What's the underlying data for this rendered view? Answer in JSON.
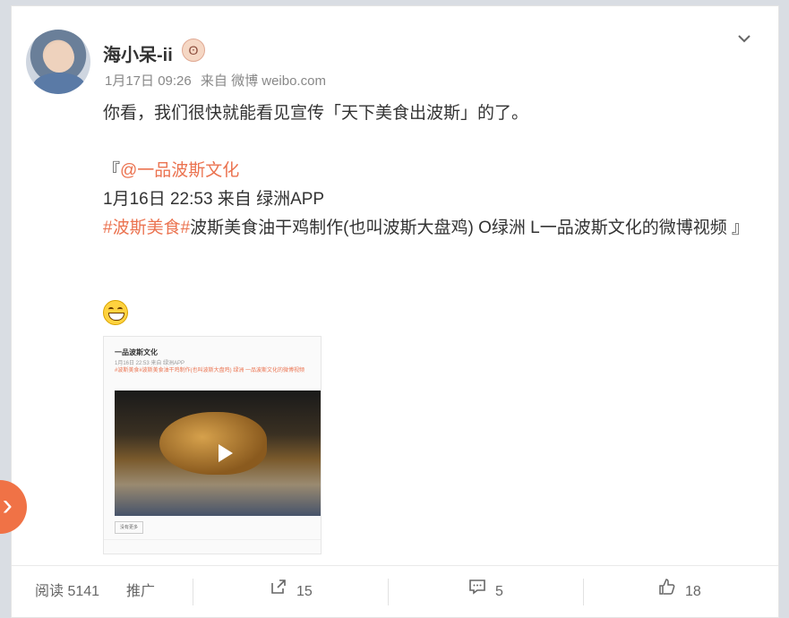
{
  "post": {
    "username": "海小呆-ii",
    "meta": {
      "date": "1月17日 09:26",
      "via": "来自 微博 weibo.com"
    },
    "text": "你看，我们很快就能看见宣传「天下美食出波斯」的了。"
  },
  "repost": {
    "open_bracket": "『",
    "mention": "@一品波斯文化",
    "time": "1月16日 22:53 来自 绿洲APP",
    "hashtag": "#波斯美食#",
    "body": "波斯美食油干鸡制作(也叫波斯大盘鸡) O绿洲 L一品波斯文化的微博视频 』"
  },
  "thumbnail": {
    "name": "一品波斯文化",
    "meta": "1月16日 22:53 来自 绿洲APP",
    "text": "#波斯美食#波斯美食油干鸡制作(也叫波斯大盘鸡) 绿洲 一品波斯文化的微博视频",
    "button": "没有更多"
  },
  "footer": {
    "reads_label": "阅读",
    "reads_count": "5141",
    "promote": "推广",
    "forward_count": "15",
    "comment_count": "5",
    "like_count": "18"
  },
  "icons": {
    "dropdown": "chevron-down-icon",
    "forward": "share-icon",
    "comment": "comment-icon",
    "like": "thumbs-up-icon",
    "side": "chevron-right-icon"
  },
  "colors": {
    "link": "#eb7350",
    "side_button": "#f07246"
  }
}
